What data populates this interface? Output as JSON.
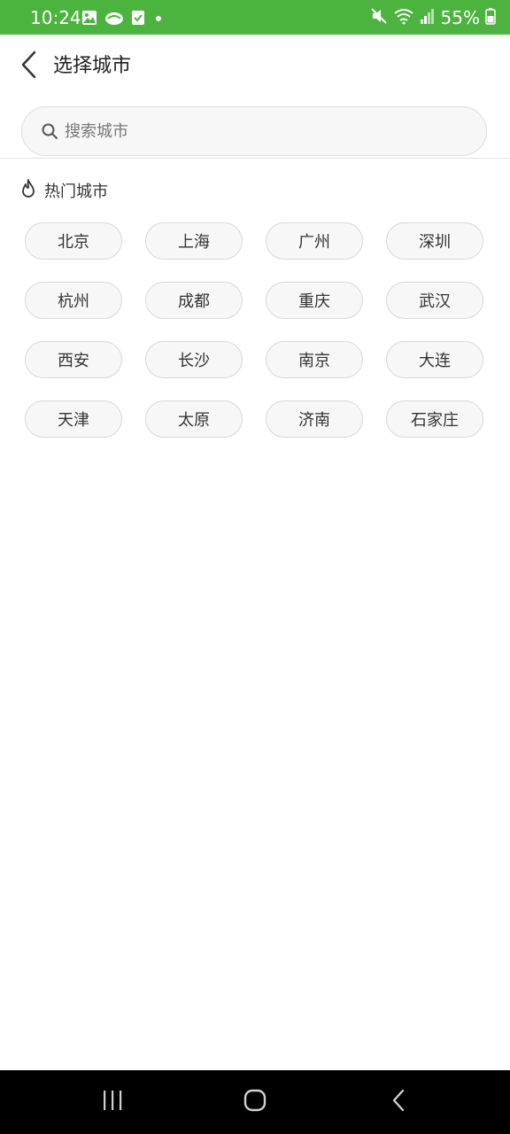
{
  "status_bar": {
    "time": "10:24",
    "battery": "55%",
    "background_color": "#4cb33e"
  },
  "header": {
    "title": "选择城市",
    "back_icon": "chevron-left-icon"
  },
  "search": {
    "placeholder": "搜索城市",
    "icon": "search-icon"
  },
  "hot_cities": {
    "title": "热门城市",
    "icon": "flame-icon",
    "cities": [
      {
        "name": "北京"
      },
      {
        "name": "上海"
      },
      {
        "name": "广州"
      },
      {
        "name": "深圳"
      },
      {
        "name": "杭州"
      },
      {
        "name": "成都"
      },
      {
        "name": "重庆"
      },
      {
        "name": "武汉"
      },
      {
        "name": "西安"
      },
      {
        "name": "长沙"
      },
      {
        "name": "南京"
      },
      {
        "name": "大连"
      },
      {
        "name": "天津"
      },
      {
        "name": "太原"
      },
      {
        "name": "济南"
      },
      {
        "name": "石家庄"
      }
    ]
  },
  "nav_bar": {
    "recents_icon": "recents-icon",
    "home_icon": "home-icon",
    "back_icon": "nav-back-icon"
  }
}
